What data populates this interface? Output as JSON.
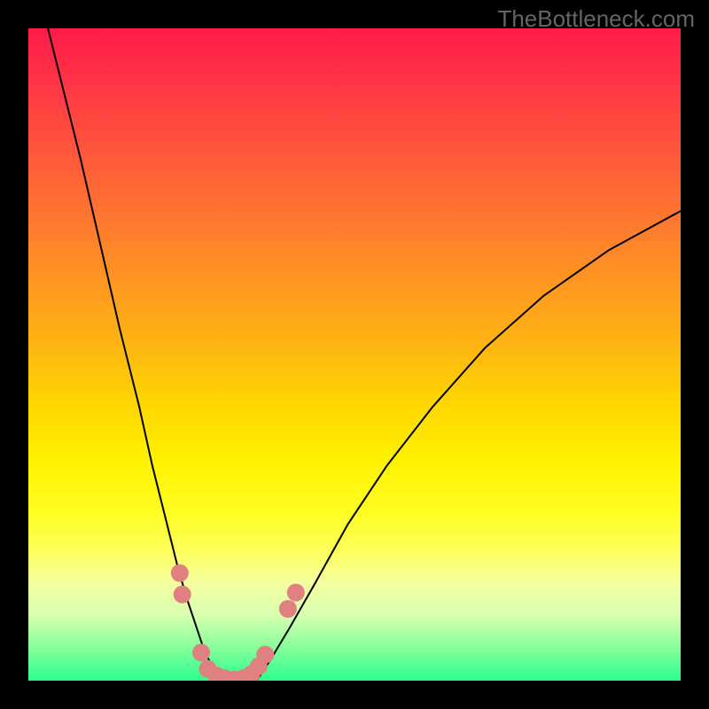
{
  "watermark": "TheBottleneck.com",
  "chart_data": {
    "type": "line",
    "title": "",
    "xlabel": "",
    "ylabel": "",
    "xlim": [
      0,
      100
    ],
    "ylim": [
      0,
      100
    ],
    "grid": false,
    "series": [
      {
        "name": "left-curve",
        "x": [
          3,
          5,
          8,
          11,
          14,
          17,
          19,
          21,
          23,
          24.5,
          26,
          27,
          28,
          29,
          30
        ],
        "y": [
          100,
          92,
          80,
          67,
          54,
          42,
          33,
          25,
          17,
          12,
          7.5,
          4.5,
          2.5,
          1,
          0
        ]
      },
      {
        "name": "right-curve",
        "x": [
          35,
          37,
          40,
          44,
          49,
          55,
          62,
          70,
          79,
          89,
          100
        ],
        "y": [
          0,
          3,
          8,
          15,
          24,
          33,
          42,
          51,
          59,
          66,
          72
        ]
      }
    ],
    "markers": {
      "name": "red-points",
      "style": "circle",
      "color": "#e08080",
      "points": [
        {
          "x": 23.2,
          "y": 16.5
        },
        {
          "x": 23.6,
          "y": 13.2
        },
        {
          "x": 26.5,
          "y": 4.3
        },
        {
          "x": 27.5,
          "y": 1.8
        },
        {
          "x": 28.8,
          "y": 0.8
        },
        {
          "x": 30.0,
          "y": 0.4
        },
        {
          "x": 31.5,
          "y": 0.2
        },
        {
          "x": 33.0,
          "y": 0.4
        },
        {
          "x": 34.2,
          "y": 1.0
        },
        {
          "x": 35.3,
          "y": 2.2
        },
        {
          "x": 36.3,
          "y": 4.0
        },
        {
          "x": 39.8,
          "y": 11.0
        },
        {
          "x": 41.0,
          "y": 13.5
        }
      ]
    },
    "background_gradient": {
      "direction": "vertical",
      "stops": [
        {
          "pos": 0,
          "color": "#ff1a4a"
        },
        {
          "pos": 50,
          "color": "#ffd800"
        },
        {
          "pos": 80,
          "color": "#feff5a"
        },
        {
          "pos": 100,
          "color": "#2cff8c"
        }
      ]
    }
  }
}
